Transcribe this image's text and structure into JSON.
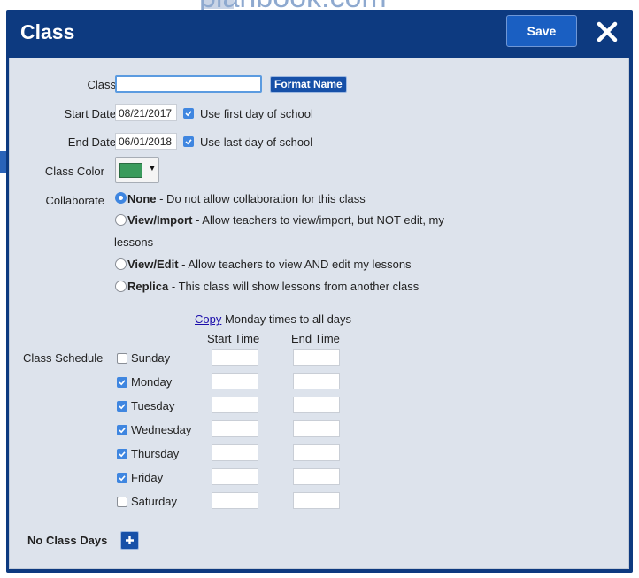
{
  "background": {
    "brand_text": "planbook.com"
  },
  "modal": {
    "title": "Class",
    "save_label": "Save",
    "close_icon": "close-icon"
  },
  "form": {
    "class_label": "Class",
    "class_value": "",
    "format_name_label": "Format Name",
    "start_date_label": "Start Date",
    "start_date_value": "08/21/2017",
    "use_first_day_label": "Use first day of school",
    "use_first_day_checked": true,
    "end_date_label": "End Date",
    "end_date_value": "06/01/2018",
    "use_last_day_label": "Use last day of school",
    "use_last_day_checked": true,
    "class_color_label": "Class Color",
    "class_color_value": "#3a9b5c",
    "collaborate_label": "Collaborate",
    "collaborate_options": [
      {
        "title": "None",
        "desc": " - Do not allow collaboration for this class",
        "selected": true
      },
      {
        "title": "View/Import",
        "desc": " - Allow teachers to view/import, but NOT edit, my",
        "desc2": "lessons",
        "selected": false
      },
      {
        "title": "View/Edit",
        "desc": " - Allow teachers to view AND edit my lessons",
        "selected": false
      },
      {
        "title": "Replica",
        "desc": " - This class will show lessons from another class",
        "selected": false
      }
    ]
  },
  "schedule": {
    "copy_link": "Copy",
    "copy_rest": " Monday times to all days",
    "start_time_header": "Start Time",
    "end_time_header": "End Time",
    "class_schedule_label": "Class Schedule",
    "days": [
      {
        "name": "Sunday",
        "checked": false,
        "start": "",
        "end": ""
      },
      {
        "name": "Monday",
        "checked": true,
        "start": "",
        "end": ""
      },
      {
        "name": "Tuesday",
        "checked": true,
        "start": "",
        "end": ""
      },
      {
        "name": "Wednesday",
        "checked": true,
        "start": "",
        "end": ""
      },
      {
        "name": "Thursday",
        "checked": true,
        "start": "",
        "end": ""
      },
      {
        "name": "Friday",
        "checked": true,
        "start": "",
        "end": ""
      },
      {
        "name": "Saturday",
        "checked": false,
        "start": "",
        "end": ""
      }
    ],
    "no_class_days_label": "No Class Days"
  }
}
